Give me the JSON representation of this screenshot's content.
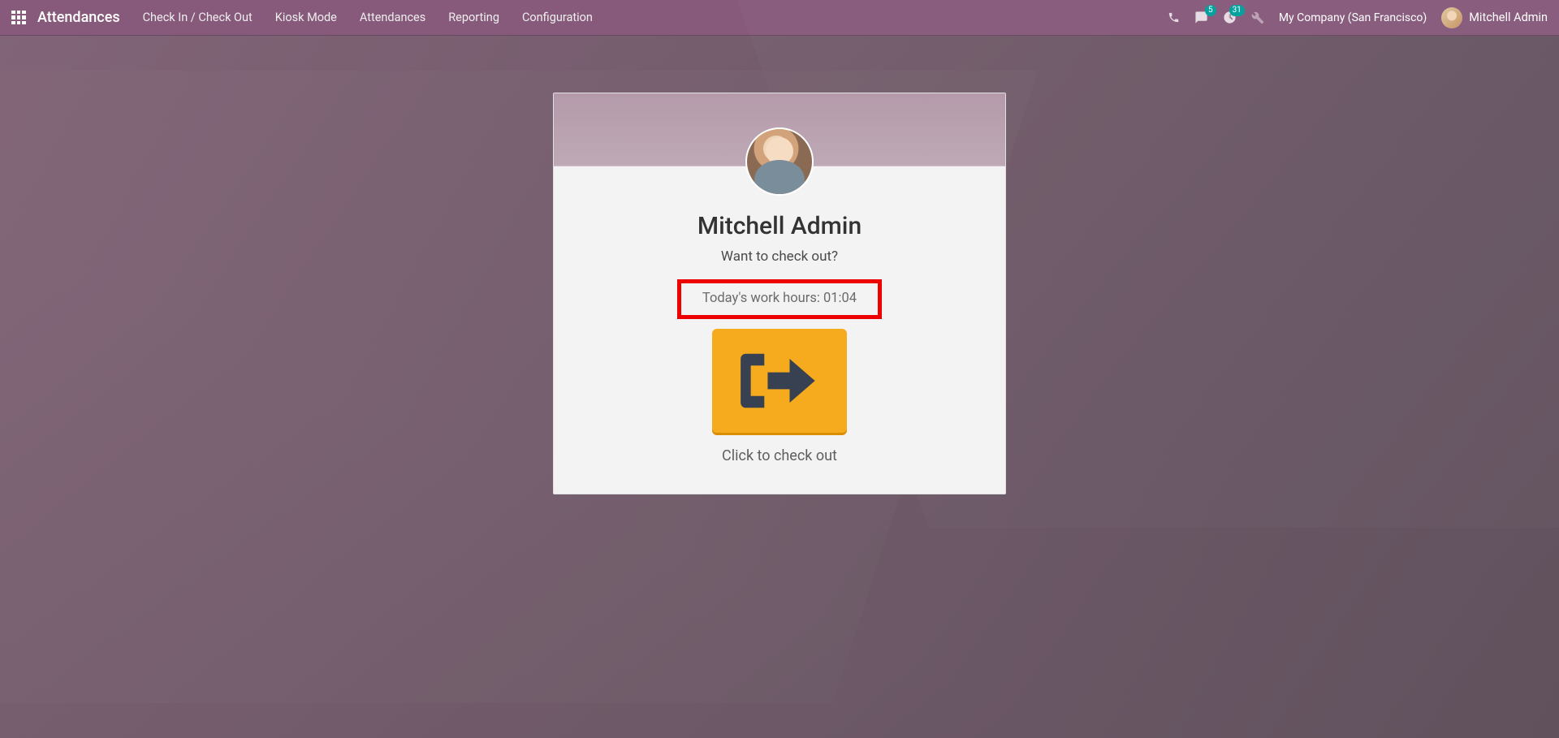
{
  "nav": {
    "brand": "Attendances",
    "menu": [
      "Check In / Check Out",
      "Kiosk Mode",
      "Attendances",
      "Reporting",
      "Configuration"
    ],
    "messages_badge": "5",
    "activities_badge": "31",
    "company": "My Company (San Francisco)",
    "user": "Mitchell Admin"
  },
  "card": {
    "employee_name": "Mitchell Admin",
    "prompt": "Want to check out?",
    "work_hours_label": "Today's work hours: ",
    "work_hours_value": "01:04",
    "button_caption": "Click to check out"
  }
}
